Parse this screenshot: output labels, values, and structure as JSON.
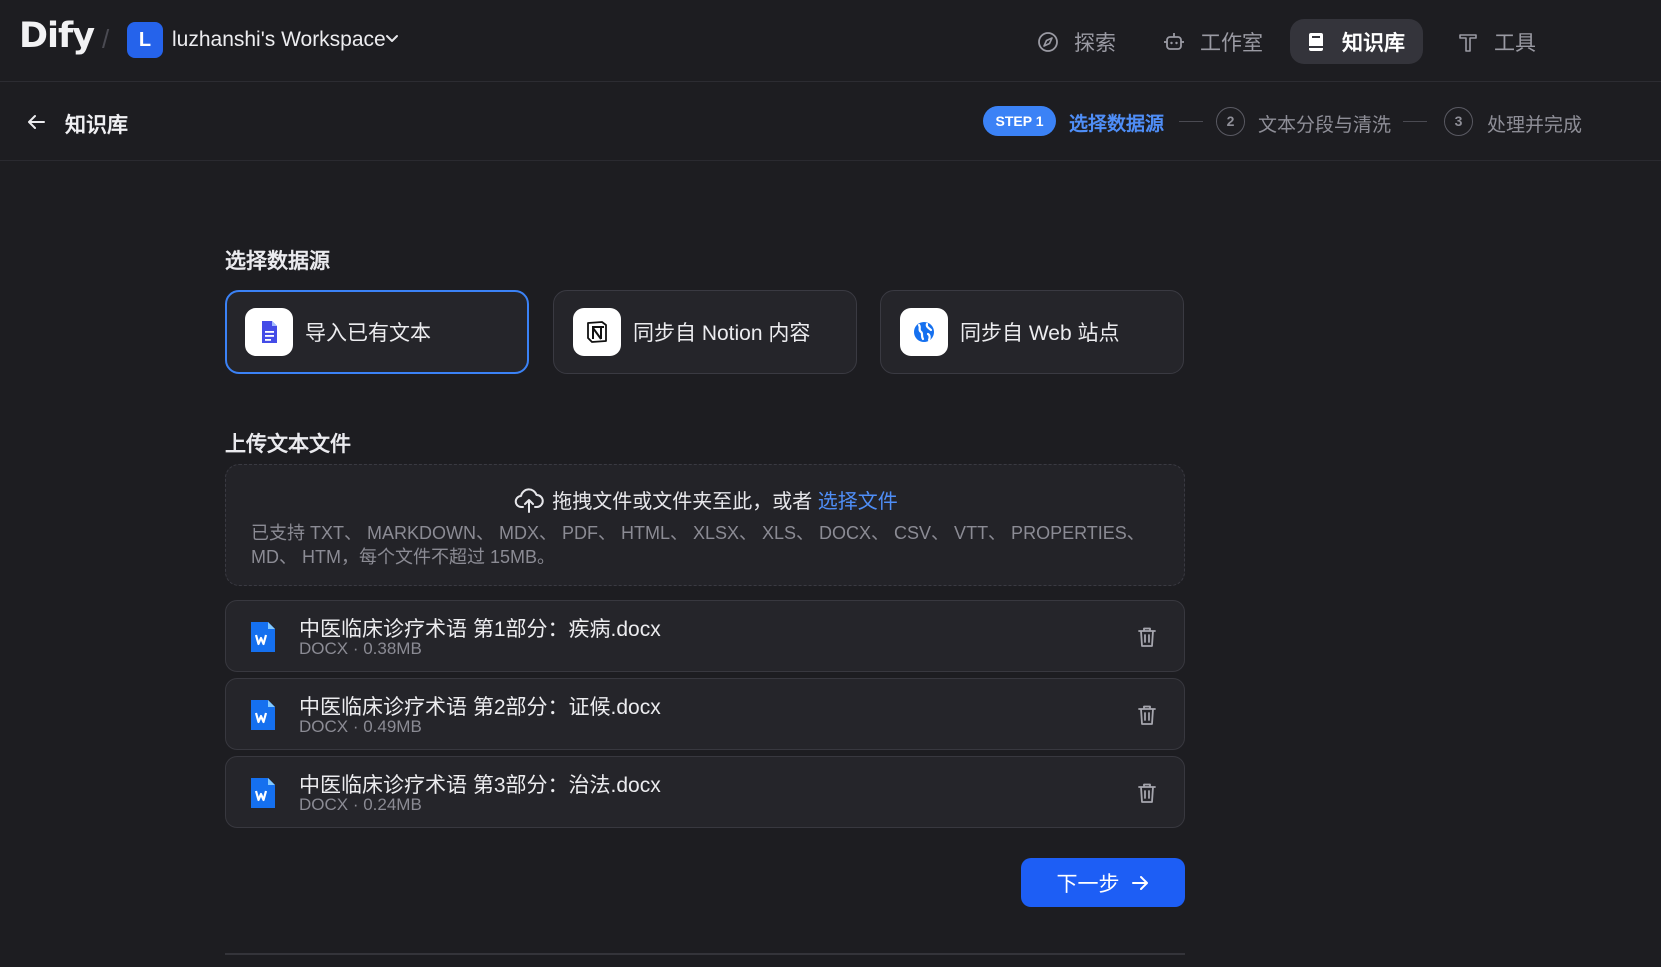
{
  "header": {
    "logo": "Dify",
    "separator": "/",
    "workspace": {
      "avatar_letter": "L",
      "name": "luzhanshi's Workspace"
    },
    "nav": [
      {
        "label": "探索",
        "icon": "compass-icon",
        "active": false
      },
      {
        "label": "工作室",
        "icon": "robot-icon",
        "active": false
      },
      {
        "label": "知识库",
        "icon": "book-icon",
        "active": true
      },
      {
        "label": "工具",
        "icon": "tools-icon",
        "active": false
      }
    ]
  },
  "subheader": {
    "title": "知识库",
    "steps": [
      {
        "badge": "STEP 1",
        "label": "选择数据源",
        "active": true
      },
      {
        "badge": "2",
        "label": "文本分段与清洗",
        "active": false
      },
      {
        "badge": "3",
        "label": "处理并完成",
        "active": false
      }
    ]
  },
  "datasource": {
    "title": "选择数据源",
    "options": [
      {
        "label": "导入已有文本",
        "icon": "document-icon",
        "selected": true
      },
      {
        "label": "同步自 Notion 内容",
        "icon": "notion-icon",
        "selected": false
      },
      {
        "label": "同步自 Web 站点",
        "icon": "globe-icon",
        "selected": false
      }
    ]
  },
  "upload": {
    "title": "上传文本文件",
    "prompt": "拖拽文件或文件夹至此，或者",
    "link": "选择文件",
    "hint_line1": "已支持 TXT、 MARKDOWN、 MDX、 PDF、 HTML、 XLSX、 XLS、 DOCX、 CSV、 VTT、 PROPERTIES、",
    "hint_line2": "MD、 HTM，每个文件不超过 15MB。"
  },
  "files": [
    {
      "name": "中医临床诊疗术语 第1部分：疾病.docx",
      "meta": "DOCX · 0.38MB"
    },
    {
      "name": "中医临床诊疗术语 第2部分：证候.docx",
      "meta": "DOCX · 0.49MB"
    },
    {
      "name": "中医临床诊疗术语 第3部分：治法.docx",
      "meta": "DOCX · 0.24MB"
    }
  ],
  "next_button": "下一步",
  "colors": {
    "accent": "#3b82f6",
    "button": "#1d5ef5",
    "background": "#1d1d21"
  }
}
